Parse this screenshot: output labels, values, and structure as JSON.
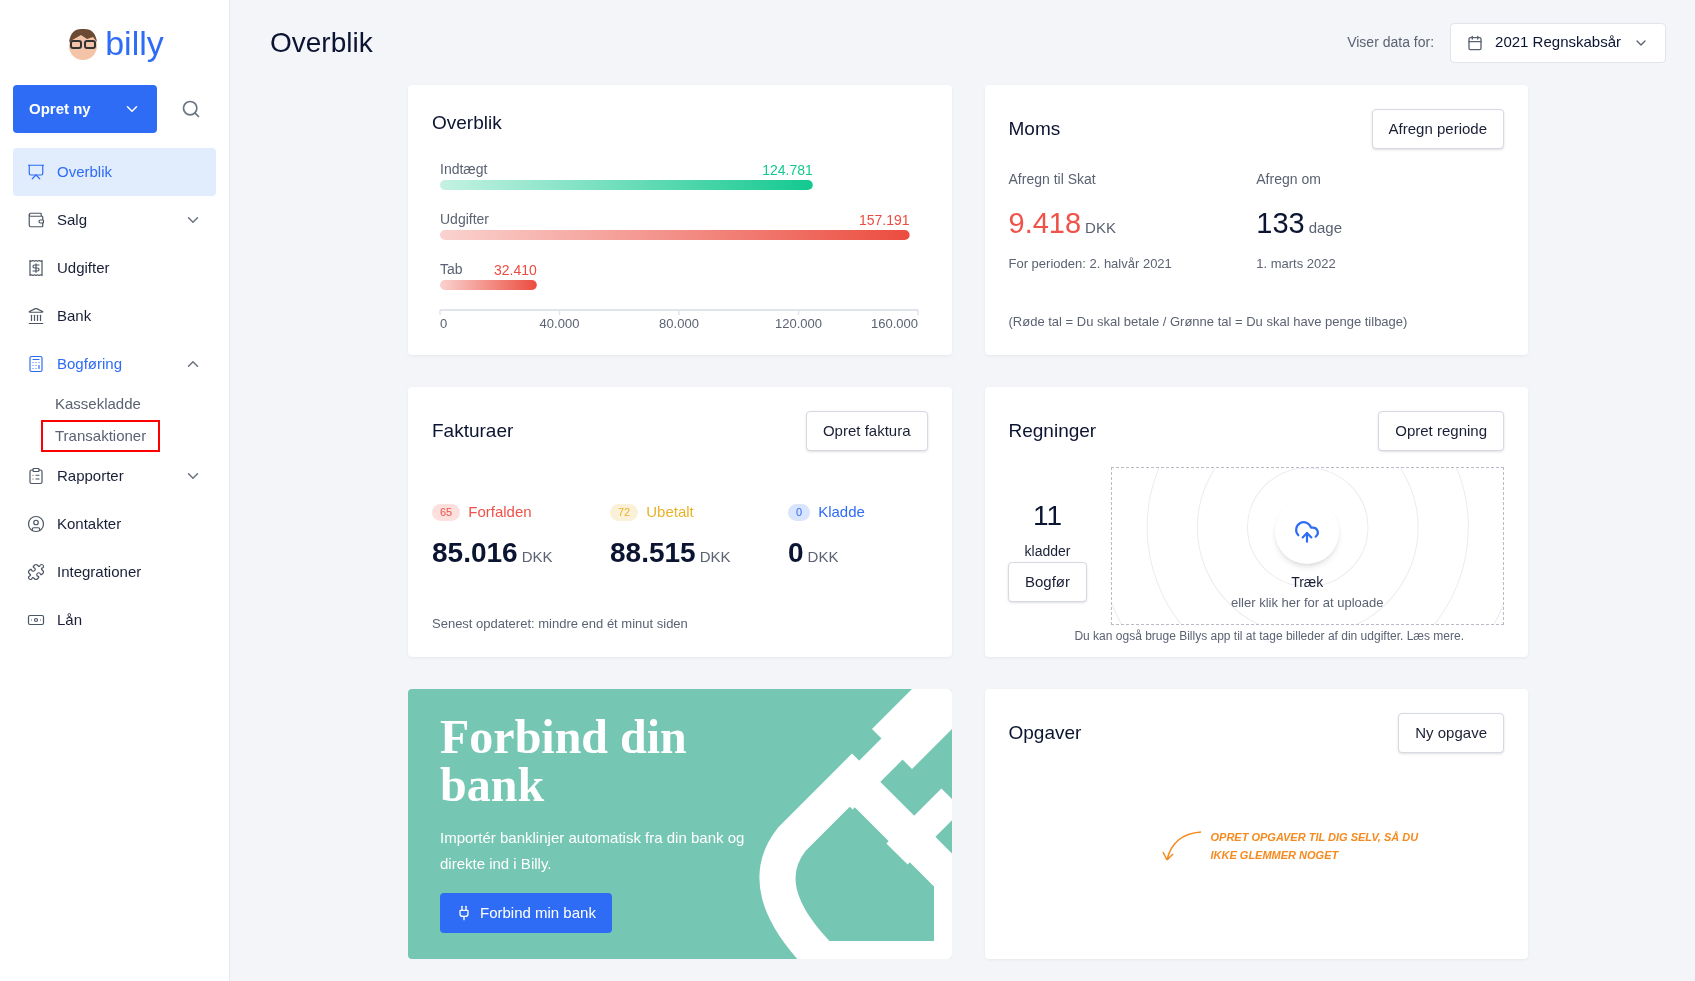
{
  "sidebar": {
    "logo": "billy",
    "create_button": "Opret ny",
    "items": [
      {
        "label": "Overblik",
        "selected": true
      },
      {
        "label": "Salg",
        "selected": false,
        "expanded": false
      },
      {
        "label": "Udgifter",
        "selected": false
      },
      {
        "label": "Bank",
        "selected": false
      },
      {
        "label": "Bogføring",
        "selected": false,
        "expanded": true,
        "children": [
          {
            "label": "Kassekladde",
            "highlighted": false
          },
          {
            "label": "Transaktioner",
            "highlighted": true
          }
        ]
      },
      {
        "label": "Rapporter",
        "selected": false,
        "expanded": false
      },
      {
        "label": "Kontakter",
        "selected": false
      },
      {
        "label": "Integrationer",
        "selected": false
      },
      {
        "label": "Lån",
        "selected": false
      }
    ]
  },
  "header": {
    "title": "Overblik",
    "period_label": "Viser data for:",
    "period_value": "2021 Regnskabsår"
  },
  "overview": {
    "title": "Overblik",
    "chart_data": {
      "type": "bar",
      "orientation": "horizontal",
      "categories": [
        "Indtægt",
        "Udgifter",
        "Tab"
      ],
      "values": [
        124781,
        157191,
        32410
      ],
      "value_labels": [
        "124.781",
        "157.191",
        "32.410"
      ],
      "colors": [
        "#13c98f",
        "#ec4c3f",
        "#ec4c3f"
      ],
      "xlim": [
        0,
        160000
      ],
      "xticks": [
        {
          "value": 0,
          "label": "0"
        },
        {
          "value": 40000,
          "label": "40.000"
        },
        {
          "value": 80000,
          "label": "80.000"
        },
        {
          "value": 120000,
          "label": "120.000"
        },
        {
          "value": 160000,
          "label": "160.000"
        }
      ]
    }
  },
  "moms": {
    "title": "Moms",
    "button": "Afregn periode",
    "left": {
      "label": "Afregn til Skat",
      "value": "9.418",
      "unit": "DKK",
      "note": "For perioden: 2. halvår 2021"
    },
    "right": {
      "label": "Afregn om",
      "value": "133",
      "unit": "dage",
      "note": "1. marts 2022"
    },
    "footnote": "(Røde tal = Du skal betale / Grønne tal = Du skal have penge tilbage)"
  },
  "invoices": {
    "title": "Fakturaer",
    "button": "Opret faktura",
    "stats": [
      {
        "count": "65",
        "label": "Forfalden",
        "color": "#f0524a",
        "amount": "85.016",
        "unit": "DKK"
      },
      {
        "count": "72",
        "label": "Ubetalt",
        "color": "#e8b32a",
        "amount": "88.515",
        "unit": "DKK"
      },
      {
        "count": "0",
        "label": "Kladde",
        "color": "#2e6cf6",
        "amount": "0",
        "unit": "DKK"
      }
    ],
    "updated": "Senest opdateret: mindre end ét minut siden"
  },
  "bills": {
    "title": "Regninger",
    "button": "Opret regning",
    "draft_count": "11",
    "draft_label": "kladder",
    "post_button": "Bogfør",
    "upload_title": "Træk",
    "upload_hint": "eller klik her for at uploade",
    "footnote": "Du kan også bruge Billys app til at tage billeder af din udgifter. Læs mere."
  },
  "bank_promo": {
    "title": "Forbind din bank",
    "text": "Importér banklinjer automatisk fra din bank og direkte ind i Billy.",
    "button": "Forbind min bank"
  },
  "tasks": {
    "title": "Opgaver",
    "button": "Ny opgave",
    "hint": "OPRET OPGAVER TIL DIG SELV, SÅ DU IKKE GLEMMER NOGET"
  }
}
